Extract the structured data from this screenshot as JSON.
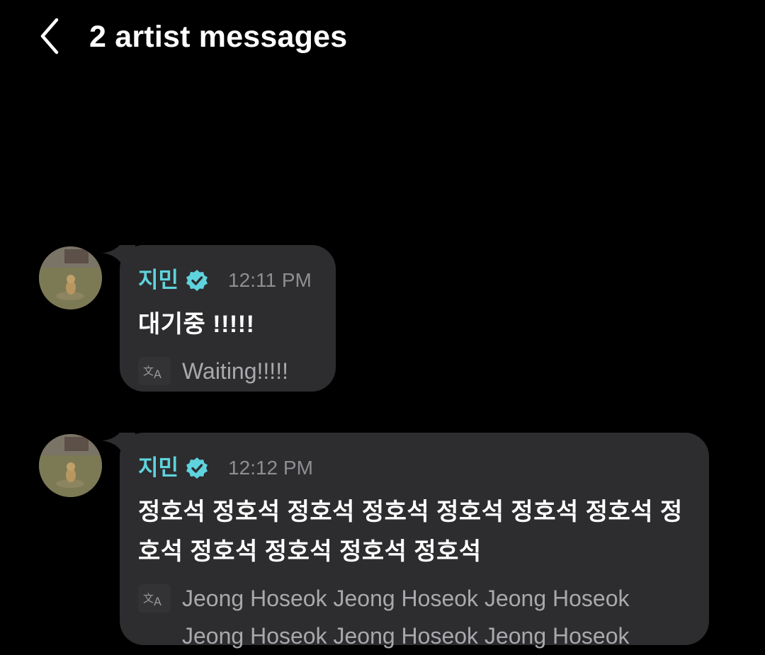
{
  "header": {
    "back_icon": "chevron-left-icon",
    "title": "2 artist messages"
  },
  "colors": {
    "background": "#000000",
    "bubble": "#2d2d2f",
    "sender_name": "#5fd3dd",
    "verified_badge": "#5fd3dd",
    "time": "#8e8e93",
    "translation_text": "#a9a9ad"
  },
  "messages": [
    {
      "sender": "지민",
      "verified_icon": "verified-badge-icon",
      "time": "12:11 PM",
      "text": "대기중 !!!!!",
      "translate_icon": "translate-icon",
      "translation": "Waiting!!!!!"
    },
    {
      "sender": "지민",
      "verified_icon": "verified-badge-icon",
      "time": "12:12 PM",
      "text": "정호석 정호석 정호석 정호석 정호석 정호석 정호석 정호석 정호석 정호석 정호석 정호석",
      "translate_icon": "translate-icon",
      "translation": "Jeong Hoseok Jeong Hoseok Jeong Hoseok Jeong Hoseok Jeong Hoseok Jeong Hoseok"
    }
  ]
}
